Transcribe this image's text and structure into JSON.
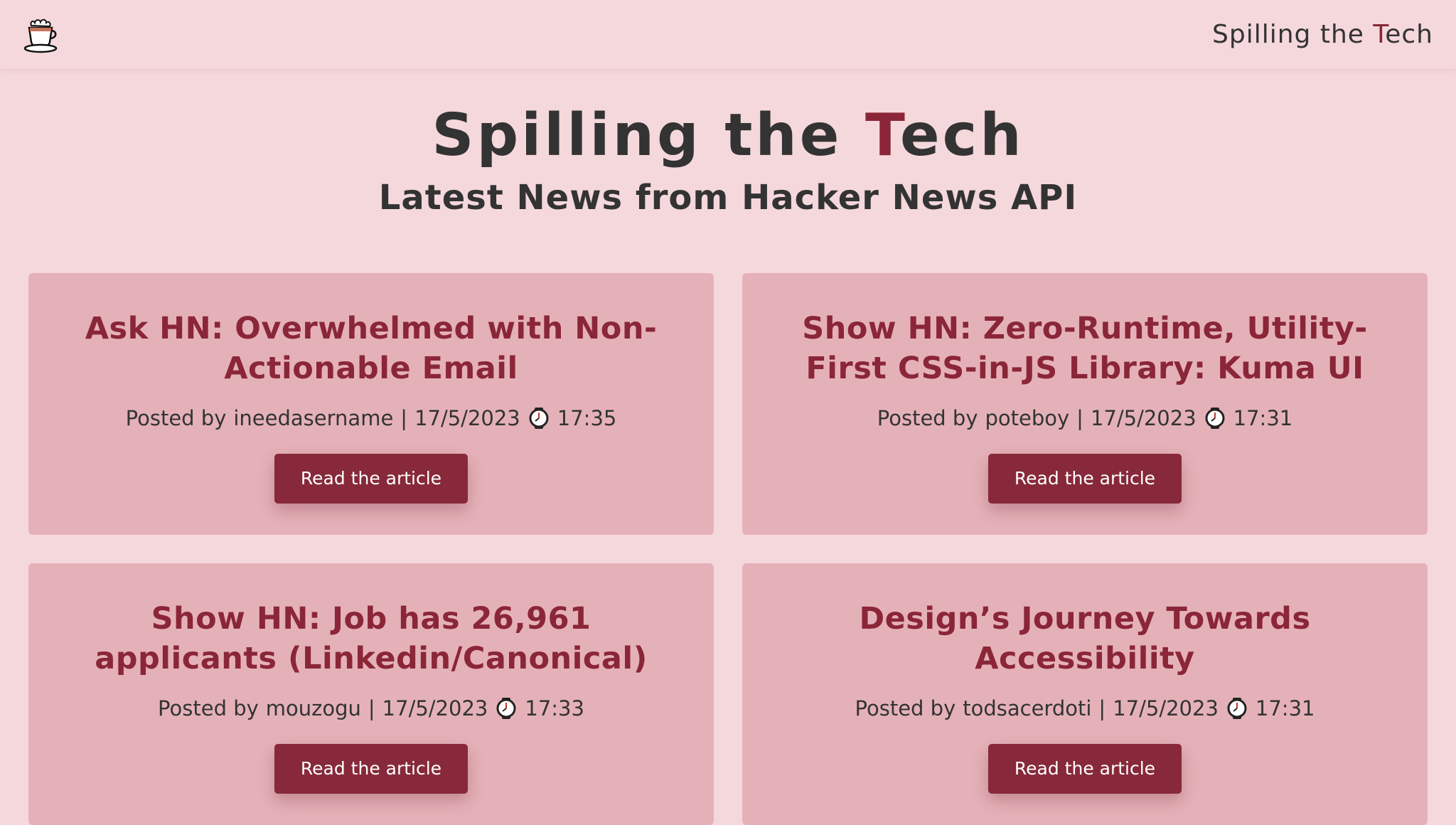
{
  "nav": {
    "brand_pre": "Spilling the ",
    "brand_accent": "T",
    "brand_post": "ech"
  },
  "hero": {
    "title_pre": "Spilling the ",
    "title_accent": "T",
    "title_post": "ech",
    "subtitle": "Latest News from Hacker News API"
  },
  "articles": [
    {
      "title": "Ask HN: Overwhelmed with Non-Actionable Email",
      "posted_by_label": "Posted by",
      "author": "ineedasername",
      "date": "17/5/2023",
      "time": "17:35",
      "button_label": "Read the article"
    },
    {
      "title": "Show HN: Zero-Runtime, Utility-First CSS-in-JS Library: Kuma UI",
      "posted_by_label": "Posted by",
      "author": "poteboy",
      "date": "17/5/2023",
      "time": "17:31",
      "button_label": "Read the article"
    },
    {
      "title": "Show HN: Job has 26,961 applicants (Linkedin/Canonical)",
      "posted_by_label": "Posted by",
      "author": "mouzogu",
      "date": "17/5/2023",
      "time": "17:33",
      "button_label": "Read the article"
    },
    {
      "title": "Design’s Journey Towards Accessibility",
      "posted_by_label": "Posted by",
      "author": "todsacerdoti",
      "date": "17/5/2023",
      "time": "17:31",
      "button_label": "Read the article"
    }
  ],
  "colors": {
    "background": "#f5d8dc",
    "card": "#e5b1b8",
    "accent": "#8a2638",
    "button": "#87293a",
    "text": "#333333"
  },
  "icons": {
    "logo": "coffee-cup-icon",
    "time": "watch-icon"
  }
}
